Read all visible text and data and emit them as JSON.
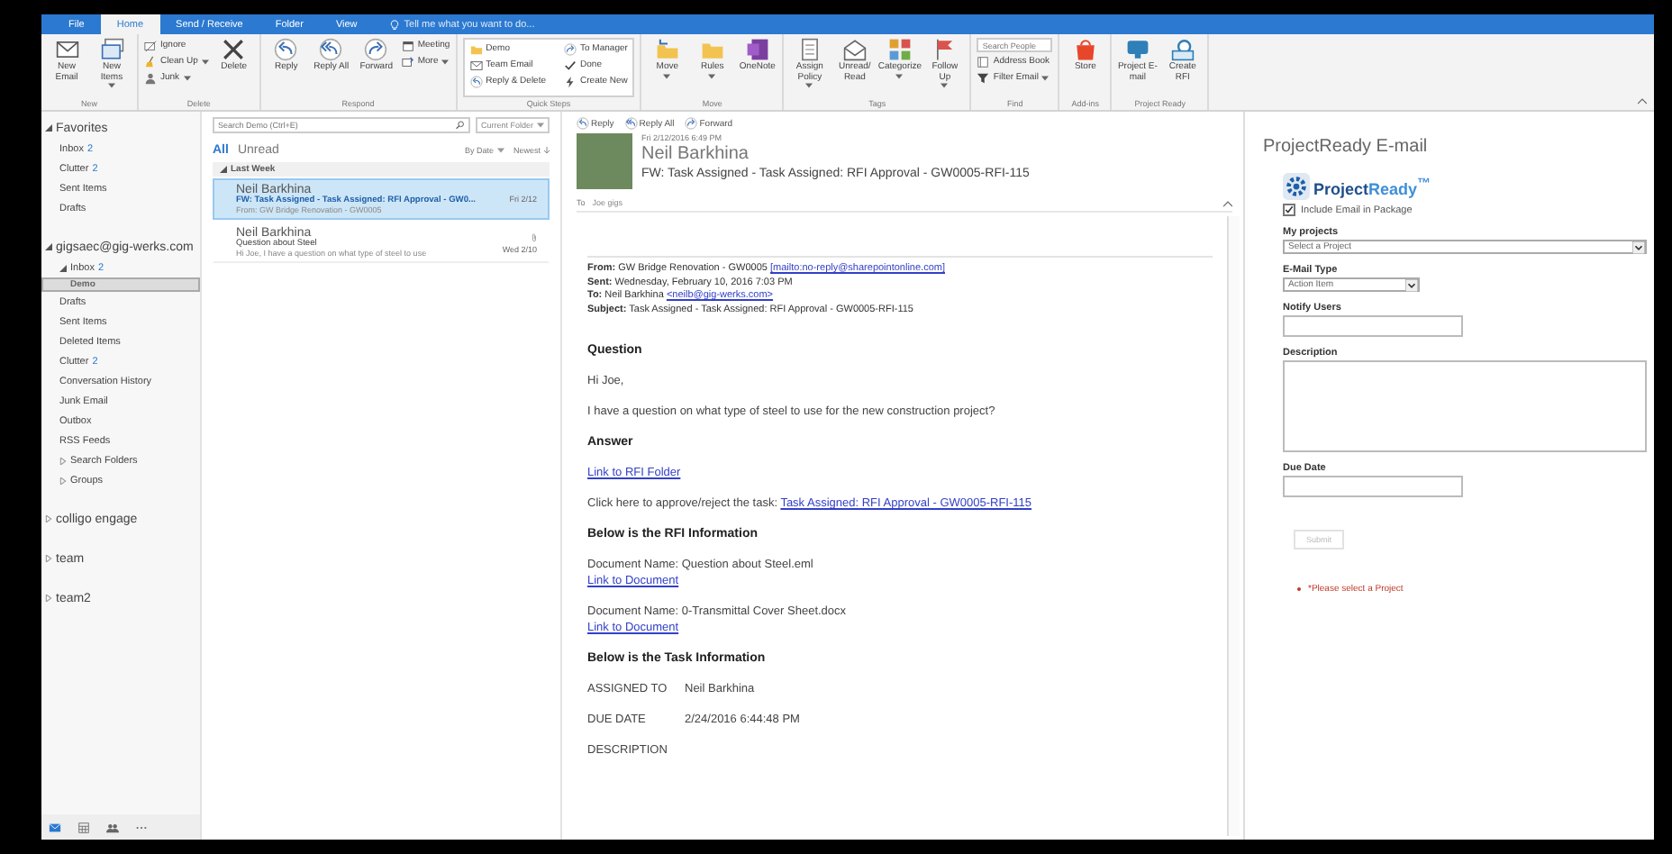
{
  "ribbon_tabs": [
    {
      "label": "File",
      "selected": false
    },
    {
      "label": "Home",
      "selected": true
    },
    {
      "label": "Send / Receive",
      "selected": false
    },
    {
      "label": "Folder",
      "selected": false
    },
    {
      "label": "View",
      "selected": false
    }
  ],
  "tell_me": {
    "placeholder": "Tell me what you want to do..."
  },
  "ribbon": {
    "groups": [
      {
        "name": "New",
        "items": [
          {
            "label": "New Email",
            "kind": "large",
            "dropdown": false
          },
          {
            "label": "New Items",
            "kind": "large",
            "dropdown": true
          }
        ]
      },
      {
        "name": "Delete",
        "items": [
          {
            "label": "Ignore",
            "kind": "small",
            "dropdown": false
          },
          {
            "label": "Clean Up",
            "kind": "small",
            "dropdown": true
          },
          {
            "label": "Junk",
            "kind": "small",
            "dropdown": true
          },
          {
            "label": "Delete",
            "kind": "large",
            "dropdown": false
          }
        ]
      },
      {
        "name": "Respond",
        "items": [
          {
            "label": "Reply",
            "kind": "large",
            "dropdown": false
          },
          {
            "label": "Reply All",
            "kind": "large",
            "dropdown": false
          },
          {
            "label": "Forward",
            "kind": "large",
            "dropdown": false
          },
          {
            "label": "Meeting",
            "kind": "small",
            "dropdown": false
          },
          {
            "label": "More",
            "kind": "small",
            "dropdown": true
          }
        ]
      },
      {
        "name": "Quick Steps",
        "items": [
          {
            "label": "Demo",
            "kind": "quickstep",
            "dropdown": false
          },
          {
            "label": "Team Email",
            "kind": "quickstep",
            "dropdown": false
          },
          {
            "label": "Reply & Delete",
            "kind": "quickstep",
            "dropdown": false
          },
          {
            "label": "To Manager",
            "kind": "quickstep",
            "dropdown": false
          },
          {
            "label": "Done",
            "kind": "quickstep",
            "dropdown": false
          },
          {
            "label": "Create New",
            "kind": "quickstep",
            "dropdown": false
          }
        ]
      },
      {
        "name": "Move",
        "items": [
          {
            "label": "Move",
            "kind": "large",
            "dropdown": true
          },
          {
            "label": "Rules",
            "kind": "large",
            "dropdown": true
          },
          {
            "label": "OneNote",
            "kind": "large",
            "dropdown": false
          }
        ]
      },
      {
        "name": "Tags",
        "items": [
          {
            "label": "Assign Policy",
            "kind": "large",
            "dropdown": true
          },
          {
            "label": "Unread/ Read",
            "kind": "large",
            "dropdown": false
          },
          {
            "label": "Categorize",
            "kind": "large",
            "dropdown": true
          },
          {
            "label": "Follow Up",
            "kind": "large",
            "dropdown": true
          }
        ]
      },
      {
        "name": "Find",
        "items": [
          {
            "placeholder": "Search People",
            "kind": "search"
          },
          {
            "label": "Address Book",
            "kind": "small",
            "dropdown": false
          },
          {
            "label": "Filter Email",
            "kind": "small",
            "dropdown": true
          }
        ]
      },
      {
        "name": "Add-ins",
        "items": [
          {
            "label": "Store",
            "kind": "large",
            "dropdown": false
          }
        ]
      },
      {
        "name": "Project Ready",
        "items": [
          {
            "label": "Project E-mail",
            "kind": "large",
            "dropdown": false
          },
          {
            "label": "Create RFI",
            "kind": "large",
            "dropdown": false
          }
        ]
      }
    ]
  },
  "sidebar": {
    "folders": [
      {
        "name": "Favorites",
        "expanded": true,
        "selected": false,
        "children": [
          {
            "name": "Inbox",
            "count": "2",
            "selected": false
          },
          {
            "name": "Clutter",
            "count": "2",
            "selected": false
          },
          {
            "name": "Sent Items",
            "selected": false
          },
          {
            "name": "Drafts",
            "selected": false
          }
        ]
      },
      {
        "name": "gigsaec@gig-werks.com",
        "expanded": true,
        "selected": false,
        "children": [
          {
            "name": "Inbox",
            "count": "2",
            "expanded": true,
            "selected": false,
            "children": [
              {
                "name": "Demo",
                "selected": true
              }
            ]
          },
          {
            "name": "Drafts",
            "selected": false
          },
          {
            "name": "Sent Items",
            "selected": false
          },
          {
            "name": "Deleted Items",
            "selected": false
          },
          {
            "name": "Clutter",
            "count": "2",
            "selected": false
          },
          {
            "name": "Conversation History",
            "selected": false
          },
          {
            "name": "Junk Email",
            "selected": false
          },
          {
            "name": "Outbox",
            "selected": false
          },
          {
            "name": "RSS Feeds",
            "selected": false
          },
          {
            "name": "Search Folders",
            "expanded": false,
            "selected": false
          },
          {
            "name": "Groups",
            "expanded": false,
            "selected": false
          }
        ]
      },
      {
        "name": "colligo engage",
        "expanded": false,
        "selected": false
      },
      {
        "name": "team",
        "expanded": false,
        "selected": false
      },
      {
        "name": "team2",
        "expanded": false,
        "selected": false
      }
    ]
  },
  "message_list": {
    "search": {
      "placeholder": "Search Demo (Ctrl+E)"
    },
    "scope": "Current Folder",
    "filters": [
      {
        "label": "All",
        "selected": true
      },
      {
        "label": "Unread",
        "selected": false
      }
    ],
    "sort": "By Date",
    "order": "Newest",
    "group": "Last Week",
    "messages": [
      {
        "sender": "Neil Barkhina",
        "subject": "FW: Task Assigned - Task Assigned: RFI Approval - GW0...",
        "preview": "From: GW Bridge Renovation - GW0005",
        "date": "Fri 2/12",
        "attachment": false,
        "selected": true
      },
      {
        "sender": "Neil Barkhina",
        "subject": "Question about Steel",
        "preview": "Hi Joe, I have a question on what type of steel to use",
        "date": "Wed 2/10",
        "attachment": true,
        "selected": false
      }
    ]
  },
  "reading_pane": {
    "actions": [
      "Reply",
      "Reply All",
      "Forward"
    ],
    "date": "Fri 2/12/2016 6:49 PM",
    "sender": "Neil Barkhina",
    "subject": "FW: Task Assigned - Task Assigned: RFI Approval - GW0005-RFI-115",
    "to_label": "To",
    "to": "Joe gigs",
    "header_lines": [
      {
        "label": "From:",
        "text": "GW Bridge Renovation - GW0005",
        "link": "[mailto:no-reply@sharepointonline.com]"
      },
      {
        "label": "Sent:",
        "text": "Wednesday, February 10, 2016 7:03 PM"
      },
      {
        "label": "To:",
        "text": "Neil Barkhina",
        "link": "<neilb@gig-werks.com>"
      },
      {
        "label": "Subject:",
        "text": "Task Assigned - Task Assigned: RFI Approval - GW0005-RFI-115"
      }
    ],
    "body": [
      {
        "kind": "heading",
        "text": "Question"
      },
      {
        "kind": "para",
        "text": "Hi Joe,"
      },
      {
        "kind": "para",
        "text": "I have a question on what type of steel to use for the new construction project?"
      },
      {
        "kind": "heading",
        "text": "Answer"
      },
      {
        "kind": "link",
        "text": "Link to RFI Folder"
      },
      {
        "kind": "para_link",
        "text": "Click here to approve/reject the task:",
        "link": "Task Assigned: RFI Approval - GW0005-RFI-115"
      },
      {
        "kind": "heading",
        "text": "Below is the RFI Information"
      },
      {
        "kind": "doc",
        "text": "Document Name: Question about Steel.eml",
        "link": "Link to Document"
      },
      {
        "kind": "doc",
        "text": "Document Name: 0-Transmittal Cover Sheet.docx",
        "link": "Link to Document"
      },
      {
        "kind": "heading",
        "text": "Below is the Task Information"
      },
      {
        "kind": "field",
        "label": "ASSIGNED TO",
        "value": "Neil Barkhina"
      },
      {
        "kind": "field",
        "label": "DUE DATE",
        "value": "2/24/2016 6:44:48 PM"
      },
      {
        "kind": "para",
        "text": "DESCRIPTION"
      }
    ]
  },
  "addin_pane": {
    "title": "ProjectReady E-mail",
    "logo_text": "Project",
    "logo_text_2": "Ready$^{™}$",
    "include_email": {
      "label": "Include Email in Package",
      "checked": true
    },
    "project_select": {
      "label": "My projects",
      "value": "Select a Project"
    },
    "email_type_select": {
      "label": "E-Mail Type",
      "value": "Action Item"
    },
    "notify_users_field": {
      "label": "Notify Users"
    },
    "description_field": {
      "label": "Description"
    },
    "due_date_field": {
      "label": "Due Date"
    },
    "submit": {
      "label": "Submit",
      "disabled": true
    },
    "error": "*Please select a Project"
  }
}
